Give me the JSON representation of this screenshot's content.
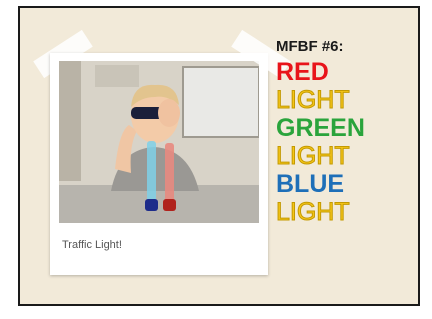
{
  "photo": {
    "caption": "Traffic Light!"
  },
  "title": {
    "heading": "MFBF #6:",
    "words": [
      {
        "text": "RED",
        "color": "#e8141a",
        "style": "bold"
      },
      {
        "text": "LIGHT",
        "color": "#f5c518",
        "style": "outline"
      },
      {
        "text": "GREEN",
        "color": "#2aa43c",
        "style": "bold"
      },
      {
        "text": "LIGHT",
        "color": "#f5c518",
        "style": "outline"
      },
      {
        "text": "BLUE",
        "color": "#1e6fb8",
        "style": "bold"
      },
      {
        "text": "LIGHT",
        "color": "#f5c518",
        "style": "outline"
      }
    ]
  }
}
